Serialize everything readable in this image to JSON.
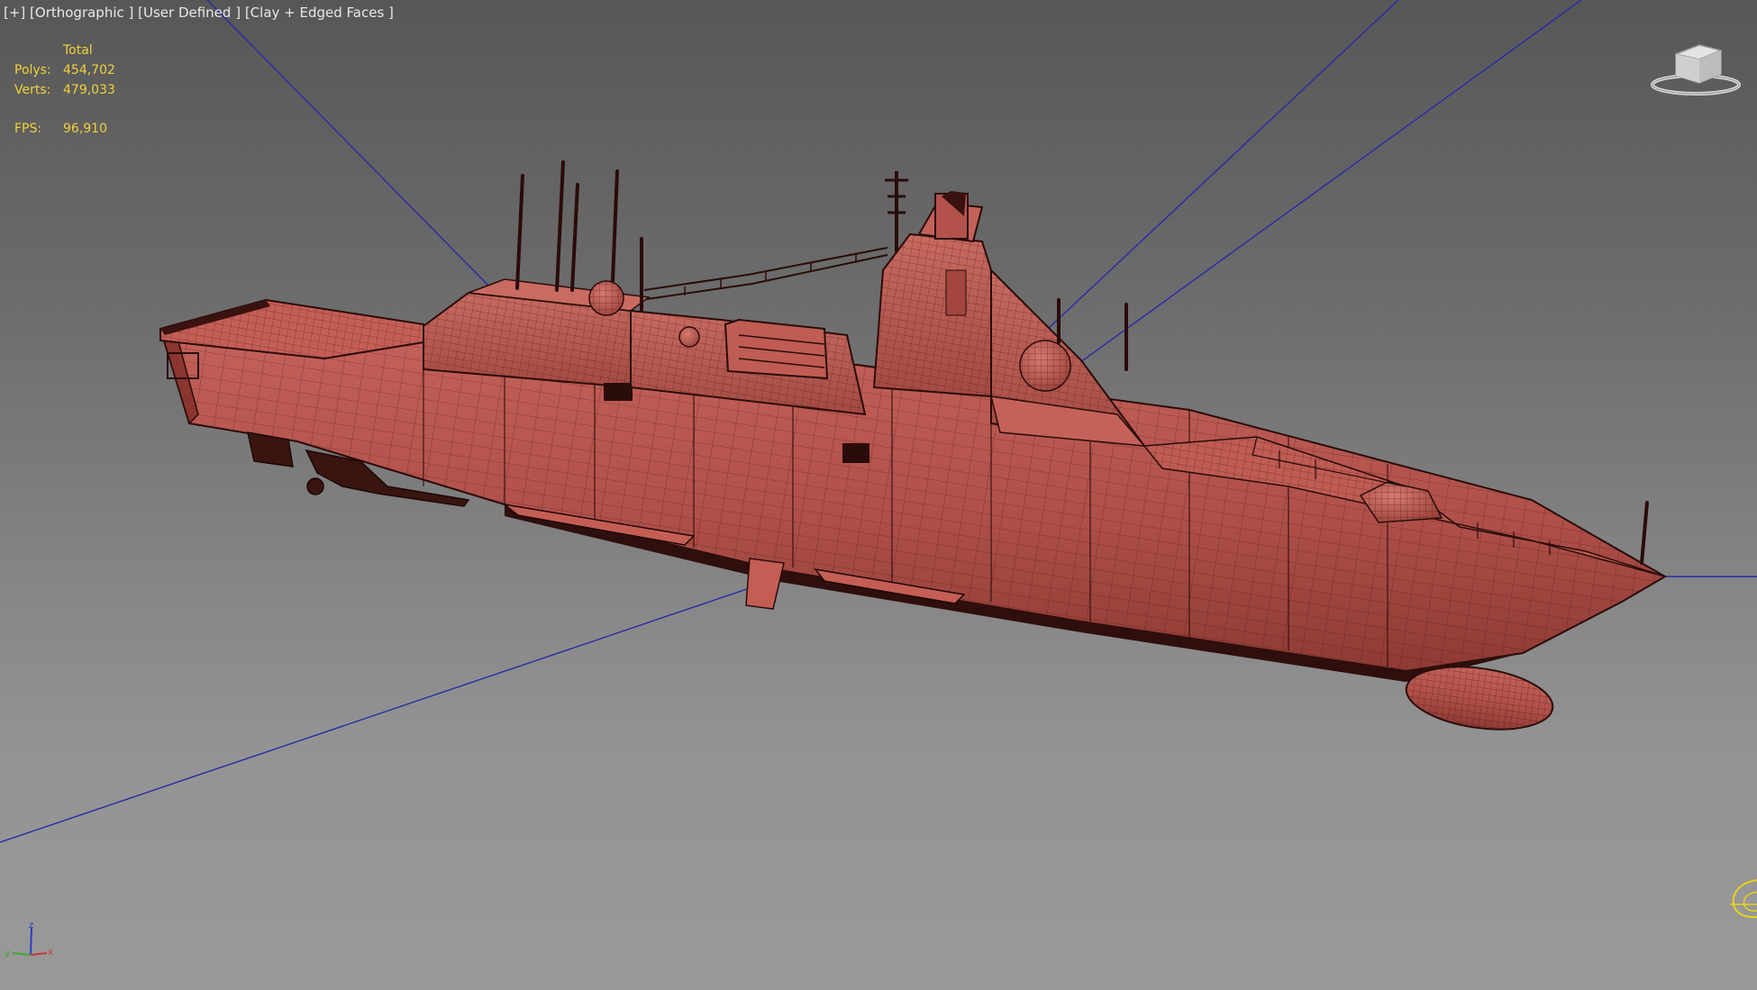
{
  "viewport": {
    "label": "[+] [Orthographic ] [User Defined ] [Clay + Edged Faces ]"
  },
  "stats": {
    "header": "Total",
    "polys_label": "Polys:",
    "polys_value": "454,702",
    "verts_label": "Verts:",
    "verts_value": "479,033",
    "fps_label": "FPS:",
    "fps_value": "96,910"
  },
  "colors": {
    "background_top": "#575757",
    "background_bottom": "#999999",
    "model_clay": "#b3524a",
    "model_edges": "#2a0c0a",
    "stats_text": "#f0d23a",
    "camera_lines": "#2a2aa8",
    "label_text": "#e8e8e8"
  },
  "icons": {
    "viewcube": "viewcube-icon",
    "axis": "axis-tripod-icon",
    "light": "light-gizmo-icon"
  },
  "axis_labels": {
    "x": "x",
    "y": "y",
    "z": "z"
  }
}
